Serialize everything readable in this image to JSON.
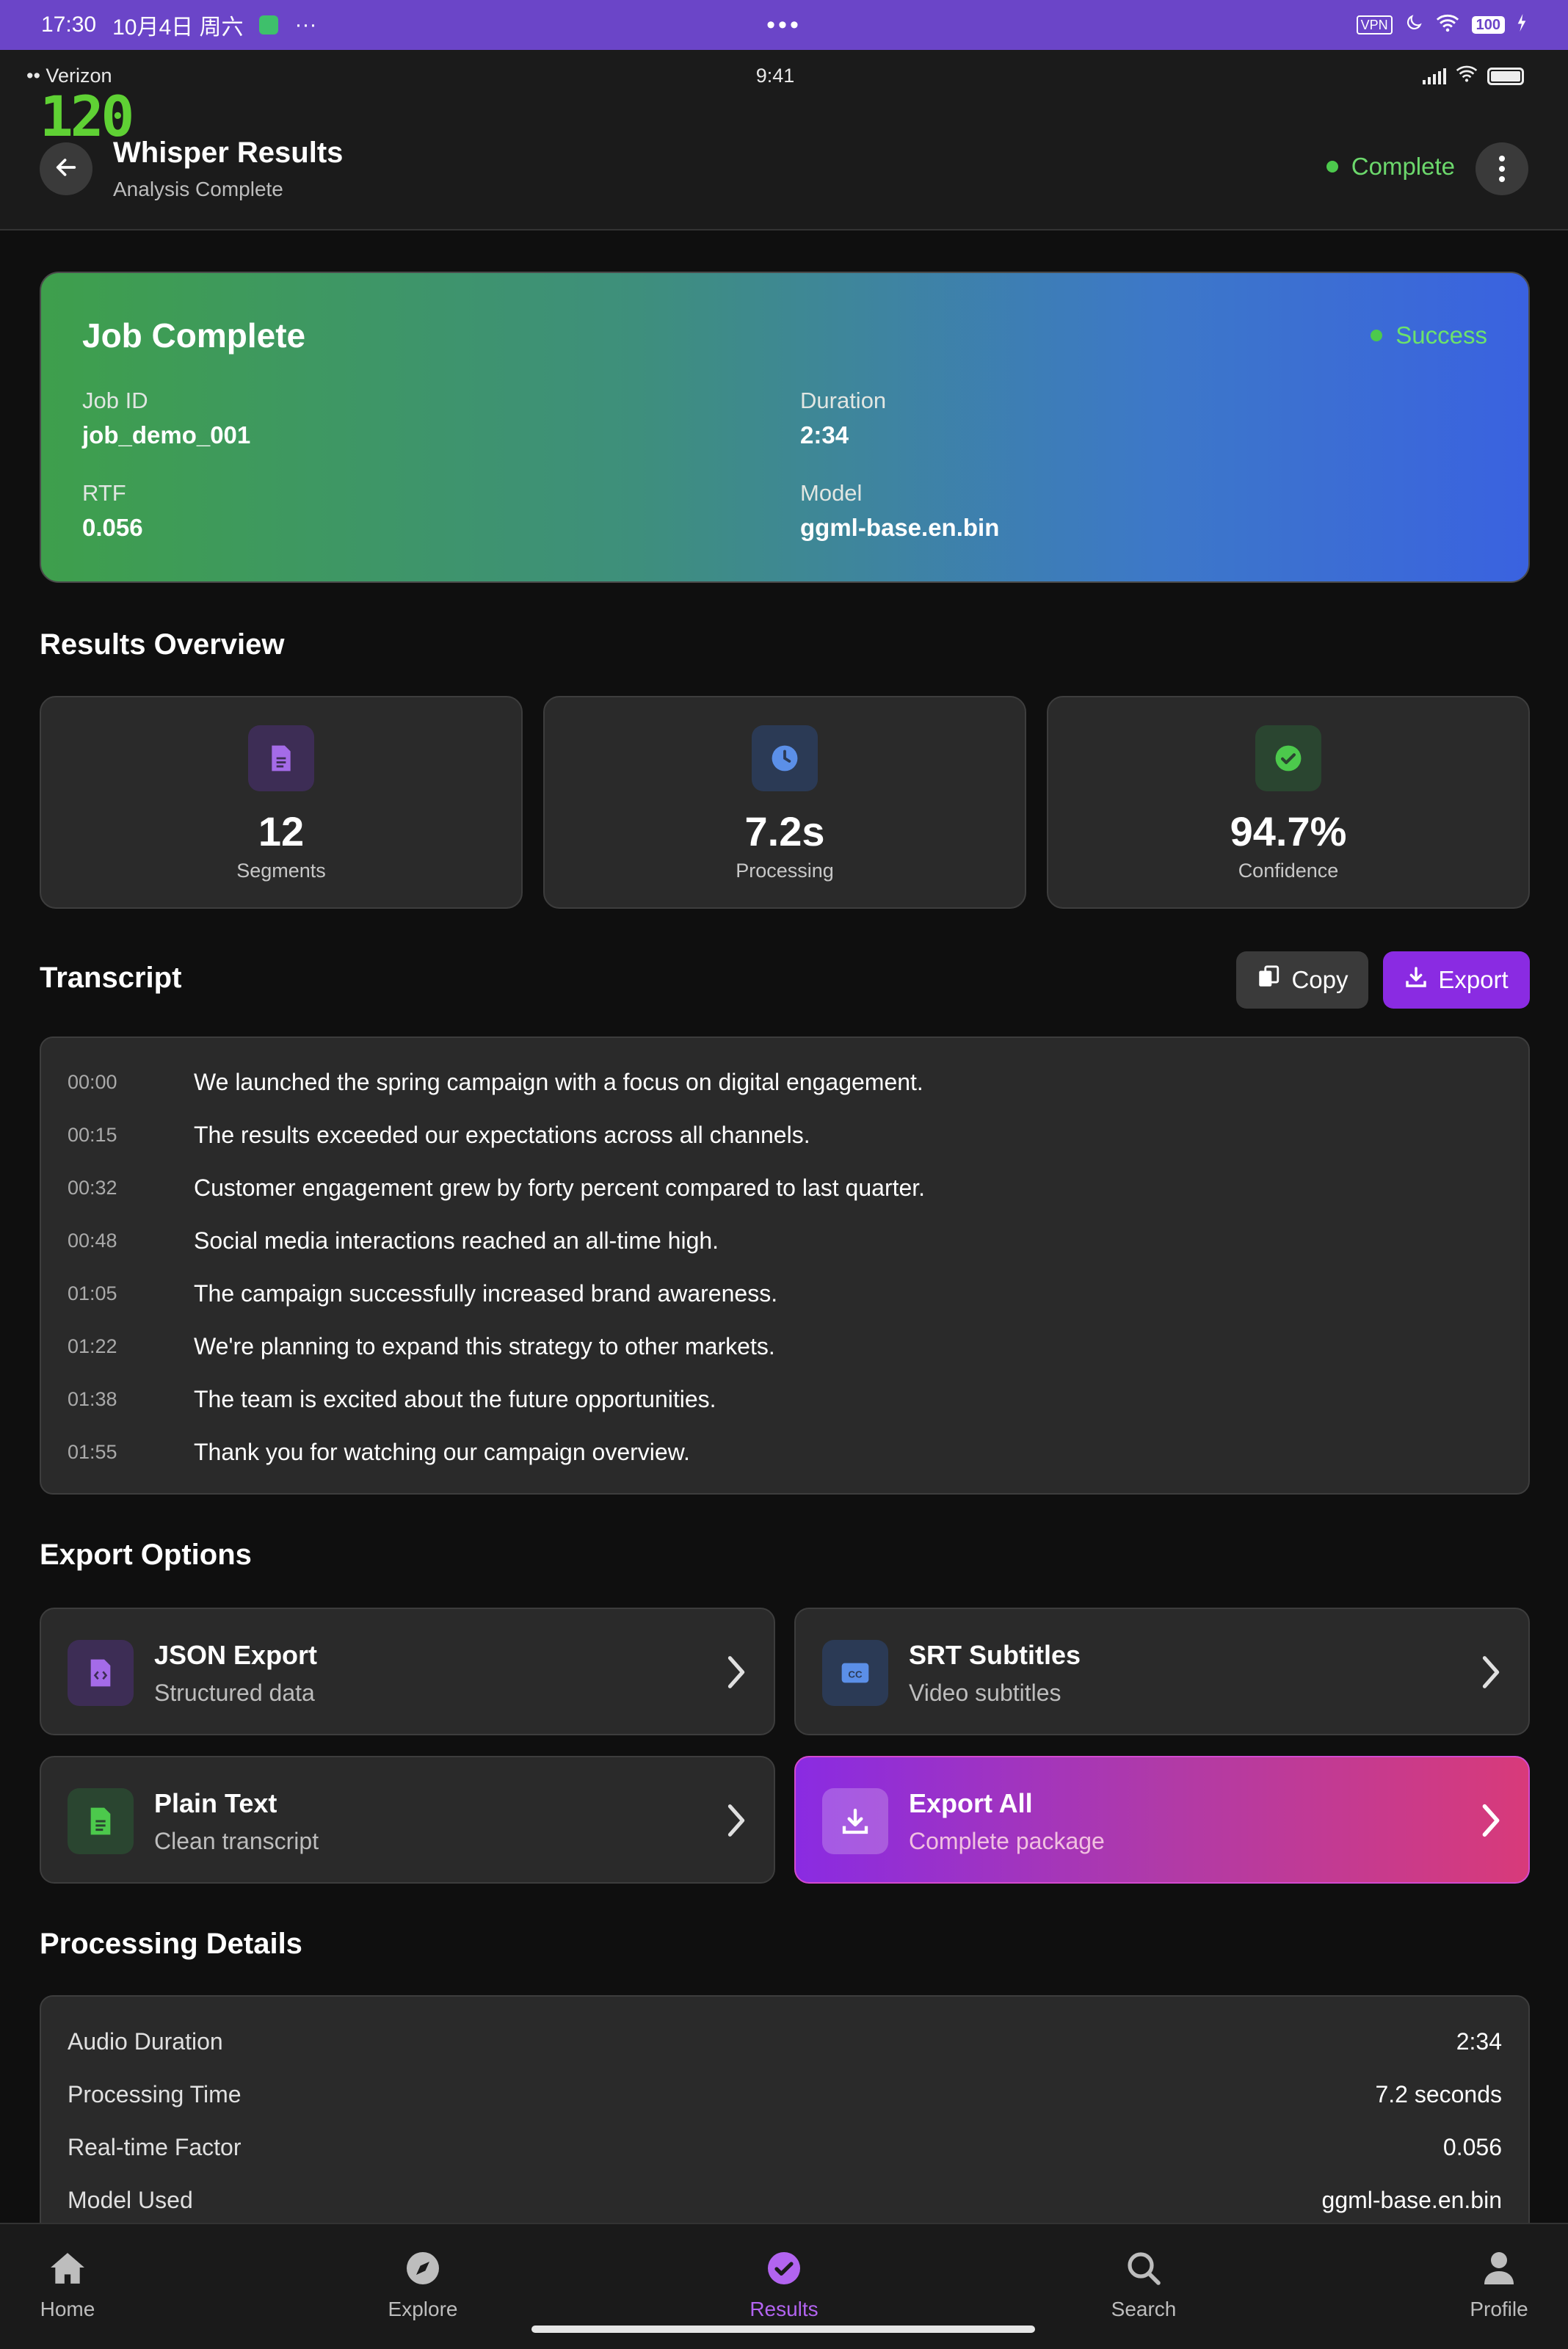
{
  "os_status": {
    "time": "17:30",
    "date": "10月4日 周六",
    "more": "···",
    "center_dots": "•••",
    "vpn": "VPN",
    "battery": "100"
  },
  "ios_status": {
    "carrier": "Verizon",
    "time": "9:41"
  },
  "fps_counter": "120",
  "header": {
    "title": "Whisper Results",
    "subtitle": "Analysis Complete",
    "status": "Complete"
  },
  "job": {
    "title": "Job Complete",
    "status": "Success",
    "fields": [
      {
        "label": "Job ID",
        "value": "job_demo_001"
      },
      {
        "label": "Duration",
        "value": "2:34"
      },
      {
        "label": "RTF",
        "value": "0.056"
      },
      {
        "label": "Model",
        "value": "ggml-base.en.bin"
      }
    ]
  },
  "overview": {
    "title": "Results Overview",
    "stats": [
      {
        "value": "12",
        "label": "Segments",
        "icon": "document-icon",
        "color": "#a46be8"
      },
      {
        "value": "7.2s",
        "label": "Processing",
        "icon": "clock-icon",
        "color": "#5b8fe8"
      },
      {
        "value": "94.7%",
        "label": "Confidence",
        "icon": "check-circle-icon",
        "color": "#4cc94c"
      }
    ]
  },
  "transcript": {
    "title": "Transcript",
    "copy_label": "Copy",
    "export_label": "Export",
    "segments": [
      {
        "time": "00:00",
        "text": "We launched the spring campaign with a focus on digital engagement."
      },
      {
        "time": "00:15",
        "text": "The results exceeded our expectations across all channels."
      },
      {
        "time": "00:32",
        "text": "Customer engagement grew by forty percent compared to last quarter."
      },
      {
        "time": "00:48",
        "text": "Social media interactions reached an all-time high."
      },
      {
        "time": "01:05",
        "text": "The campaign successfully increased brand awareness."
      },
      {
        "time": "01:22",
        "text": "We're planning to expand this strategy to other markets."
      },
      {
        "time": "01:38",
        "text": "The team is excited about the future opportunities."
      },
      {
        "time": "01:55",
        "text": "Thank you for watching our campaign overview."
      }
    ]
  },
  "export_options": {
    "title": "Export Options",
    "items": [
      {
        "title": "JSON Export",
        "subtitle": "Structured data",
        "icon": "json-file-icon"
      },
      {
        "title": "SRT Subtitles",
        "subtitle": "Video subtitles",
        "icon": "cc-icon"
      },
      {
        "title": "Plain Text",
        "subtitle": "Clean transcript",
        "icon": "text-file-icon"
      },
      {
        "title": "Export All",
        "subtitle": "Complete package",
        "icon": "download-icon"
      }
    ]
  },
  "processing_details": {
    "title": "Processing Details",
    "rows": [
      {
        "label": "Audio Duration",
        "value": "2:34"
      },
      {
        "label": "Processing Time",
        "value": "7.2 seconds"
      },
      {
        "label": "Real-time Factor",
        "value": "0.056"
      },
      {
        "label": "Model Used",
        "value": "ggml-base.en.bin"
      }
    ]
  },
  "bottom_nav": {
    "items": [
      {
        "label": "Home",
        "icon": "home-icon"
      },
      {
        "label": "Explore",
        "icon": "compass-icon"
      },
      {
        "label": "Results",
        "icon": "check-circle-icon",
        "active": true
      },
      {
        "label": "Search",
        "icon": "search-icon"
      },
      {
        "label": "Profile",
        "icon": "person-icon"
      }
    ]
  },
  "colors": {
    "accent": "#8a2be2",
    "success": "#4cc94c",
    "background": "#0f0f0f",
    "card": "#2a2a2a"
  }
}
